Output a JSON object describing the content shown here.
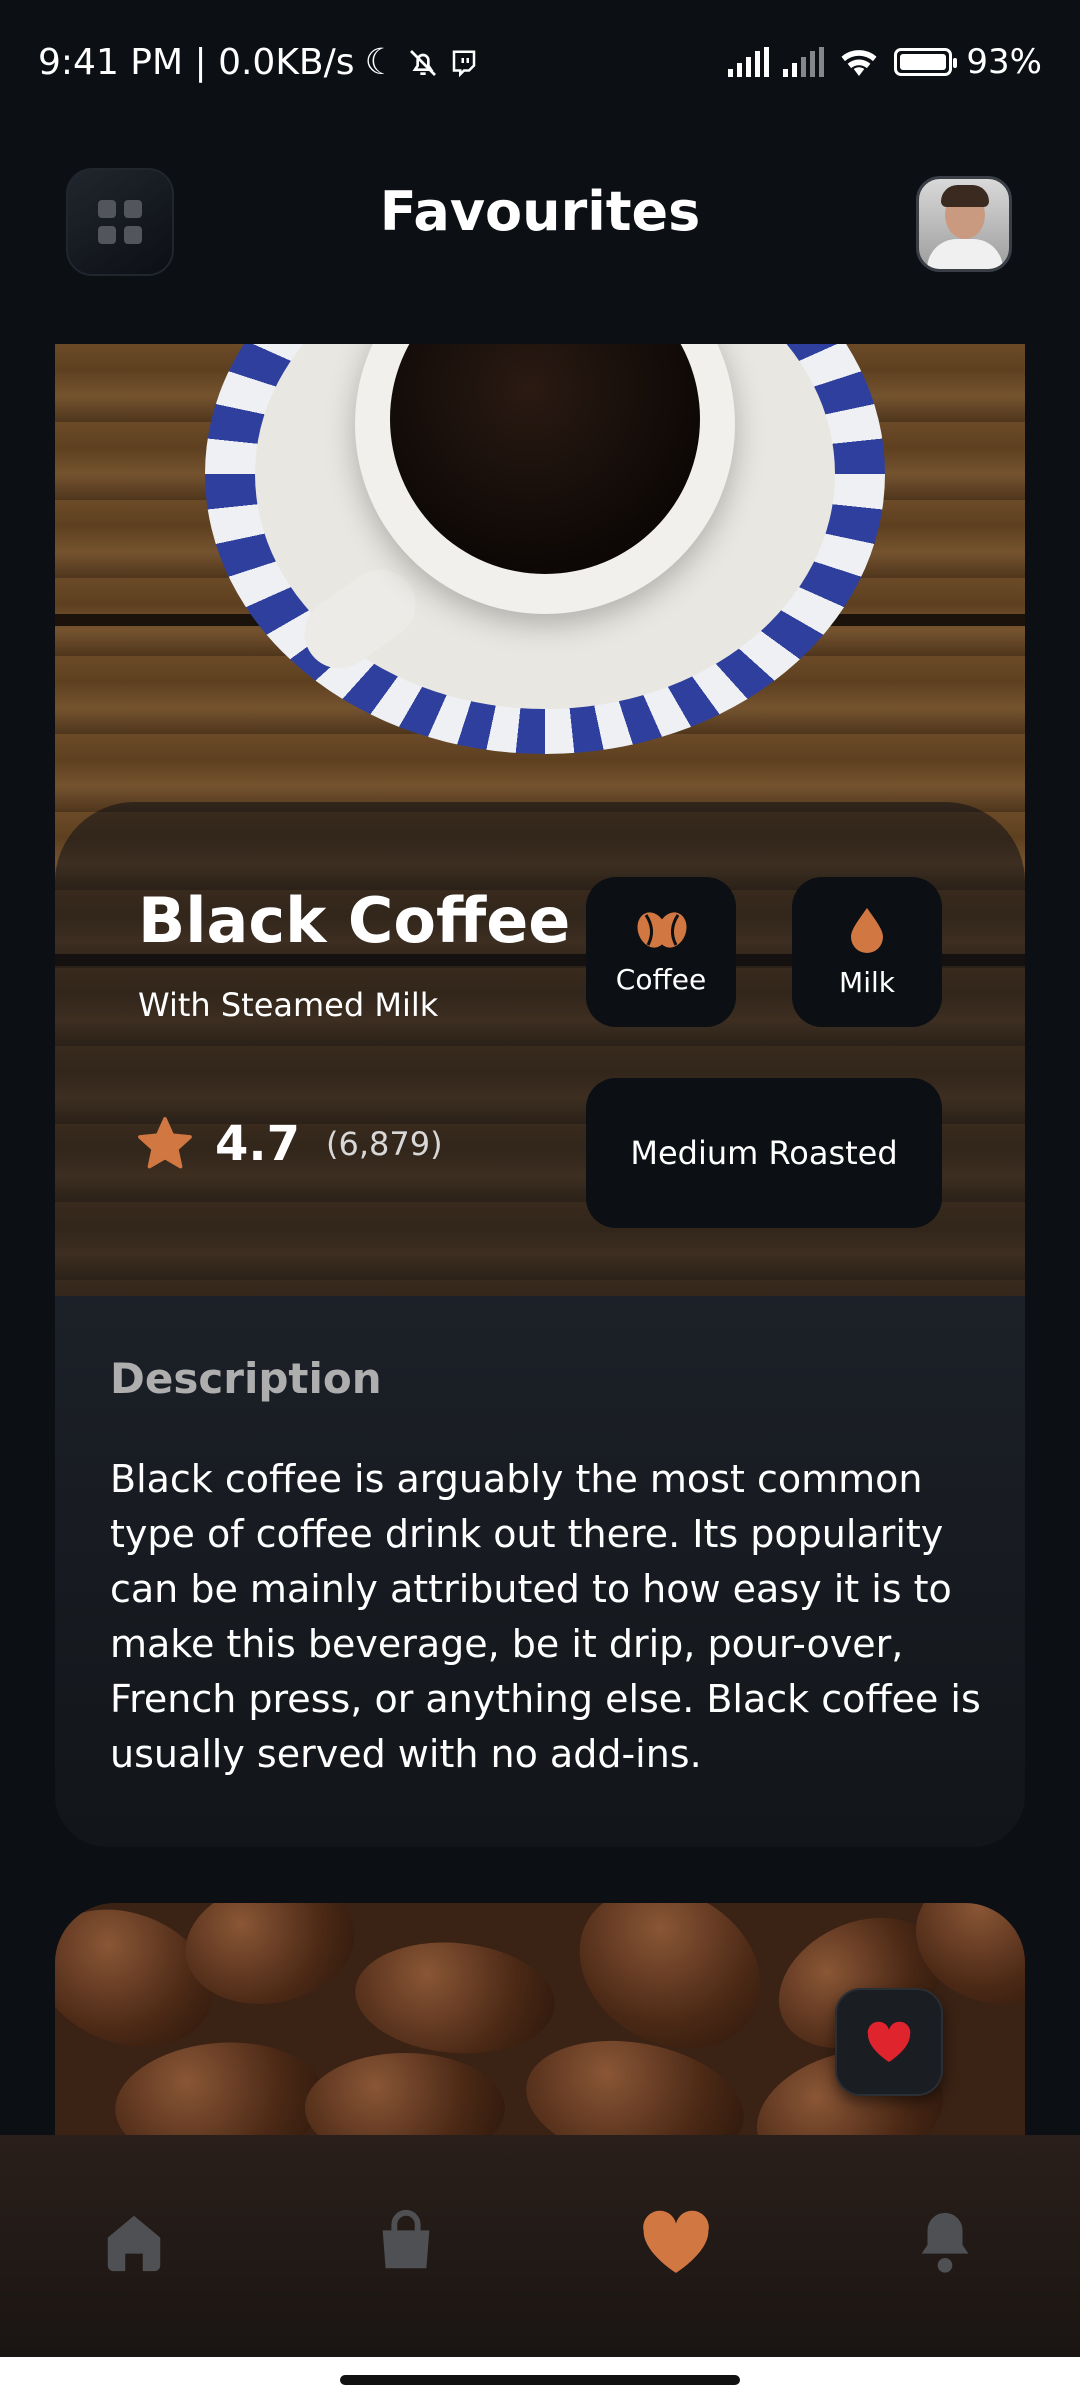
{
  "status_bar": {
    "time_info": "9:41 PM | 0.0KB/s",
    "battery": "93%"
  },
  "header": {
    "title": "Favourites"
  },
  "product": {
    "name": "Black Coffee",
    "subtitle": "With Steamed Milk",
    "rating": "4.7",
    "rating_count": "(6,879)",
    "tags": {
      "coffee": "Coffee",
      "milk": "Milk",
      "roast": "Medium Roasted"
    },
    "description_title": "Description",
    "description": "Black coffee is arguably the most common type of coffee drink out there. Its popularity can be mainly attributed to how easy it is to make this beverage, be it drip, pour-over, French press, or anything else. Black coffee is usually served with no add-ins."
  },
  "nav": {
    "items": [
      "home-icon",
      "bag-icon",
      "heart-icon",
      "bell-icon"
    ],
    "active": "heart-icon"
  },
  "colors": {
    "accent": "#d17842",
    "background": "#0c0f14",
    "card": "#1d2129",
    "favorite_red": "#e0242d"
  }
}
